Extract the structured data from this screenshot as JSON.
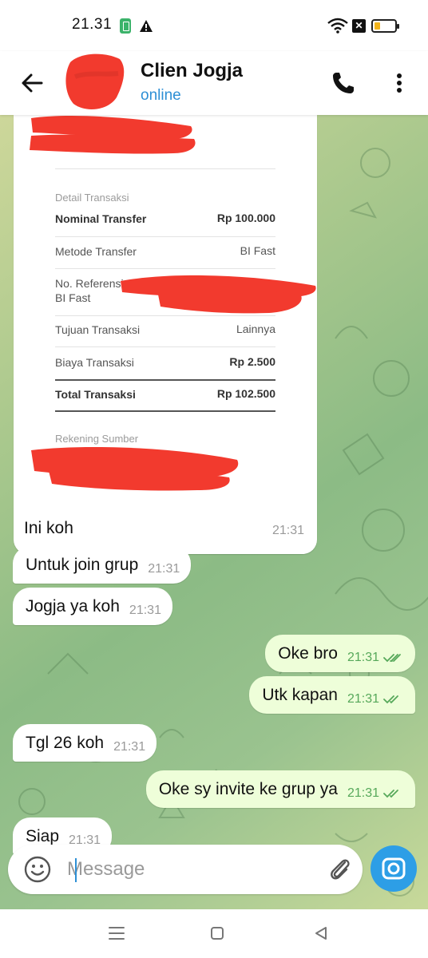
{
  "status_bar": {
    "time": "21.31"
  },
  "header": {
    "contact_name": "Clien Jogja",
    "contact_status": "online"
  },
  "receipt": {
    "section_title": "Detail Transaksi",
    "rows": [
      {
        "label": "Nominal Transfer",
        "value": "Rp 100.000"
      },
      {
        "label": "Metode Transfer",
        "value": "BI Fast"
      },
      {
        "label": "No. Referensi BI Fast",
        "value": ""
      },
      {
        "label": "Tujuan Transaksi",
        "value": "Lainnya"
      },
      {
        "label": "Biaya Transaksi",
        "value": "Rp 2.500"
      },
      {
        "label": "Total Transaksi",
        "value": "Rp 102.500"
      }
    ],
    "source_title": "Rekening Sumber",
    "caption": "Ini koh",
    "time": "21:31"
  },
  "messages": [
    {
      "text": "Untuk join grup",
      "time": "21:31",
      "direction": "in"
    },
    {
      "text": "Jogja ya koh",
      "time": "21:31",
      "direction": "in"
    },
    {
      "text": "Oke bro",
      "time": "21:31",
      "direction": "out",
      "status": "read"
    },
    {
      "text": "Utk kapan",
      "time": "21:31",
      "direction": "out",
      "status": "read"
    },
    {
      "text": "Tgl 26 koh",
      "time": "21:31",
      "direction": "in"
    },
    {
      "text": "Oke sy invite ke grup ya",
      "time": "21:31",
      "direction": "out",
      "status": "read"
    },
    {
      "text": "Siap",
      "time": "21:31",
      "direction": "in"
    }
  ],
  "input": {
    "placeholder": "Message"
  },
  "icons": {
    "back": "arrow-left-icon",
    "call": "phone-icon",
    "menu": "more-vertical-icon",
    "emoji": "smiley-icon",
    "attach": "paperclip-icon",
    "camera": "camera-icon",
    "read": "double-check-icon"
  },
  "colors": {
    "accent": "#2d9ee6",
    "outgoing_bubble": "#eefed9",
    "read_check": "#56a85a",
    "redaction": "#f23a2e"
  }
}
